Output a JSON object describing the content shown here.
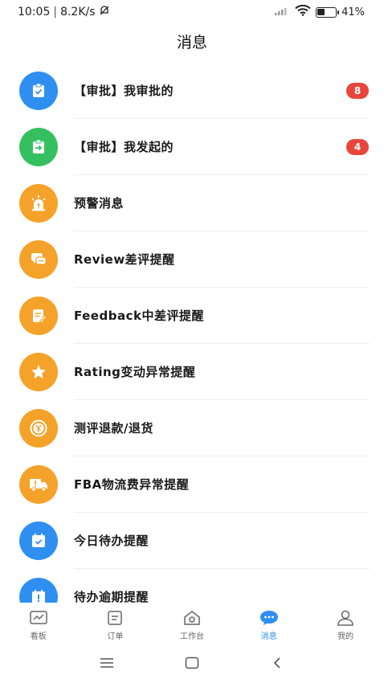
{
  "status_bar": {
    "time": "10:05",
    "net_speed": "8.2K/s",
    "battery_text": "41%",
    "battery_level": 0.41
  },
  "header": {
    "title": "消息"
  },
  "messages": [
    {
      "label": "【审批】我审批的",
      "badge": "8",
      "icon": "clipboard-check-icon",
      "color": "#2f8ff0"
    },
    {
      "label": "【审批】我发起的",
      "badge": "4",
      "icon": "clipboard-arrow-icon",
      "color": "#35c05f"
    },
    {
      "label": "预警消息",
      "icon": "alarm-light-icon",
      "color": "#f5a22a"
    },
    {
      "label": "Review差评提醒",
      "icon": "chat-bubbles-icon",
      "color": "#f5a22a"
    },
    {
      "label": "Feedback中差评提醒",
      "icon": "edit-note-icon",
      "color": "#f5a22a"
    },
    {
      "label": "Rating变动异常提醒",
      "icon": "star-icon",
      "color": "#f5a22a"
    },
    {
      "label": "测评退款/退货",
      "icon": "yen-coin-icon",
      "color": "#f5a22a"
    },
    {
      "label": "FBA物流费异常提醒",
      "icon": "truck-alert-icon",
      "color": "#f5a22a"
    },
    {
      "label": "今日待办提醒",
      "icon": "calendar-check-icon",
      "color": "#2f8ff0"
    },
    {
      "label": "待办逾期提醒",
      "icon": "calendar-alert-icon",
      "color": "#2f8ff0"
    }
  ],
  "tabs": [
    {
      "label": "看板",
      "icon": "dashboard-icon",
      "active": false
    },
    {
      "label": "订单",
      "icon": "order-list-icon",
      "active": false
    },
    {
      "label": "工作台",
      "icon": "workbench-home-icon",
      "active": false
    },
    {
      "label": "消息",
      "icon": "message-bubble-icon",
      "active": true
    },
    {
      "label": "我的",
      "icon": "user-profile-icon",
      "active": false
    }
  ],
  "colors": {
    "accent": "#2f8ff0",
    "badge": "#e8463c",
    "warning": "#f5a22a",
    "success": "#35c05f"
  }
}
